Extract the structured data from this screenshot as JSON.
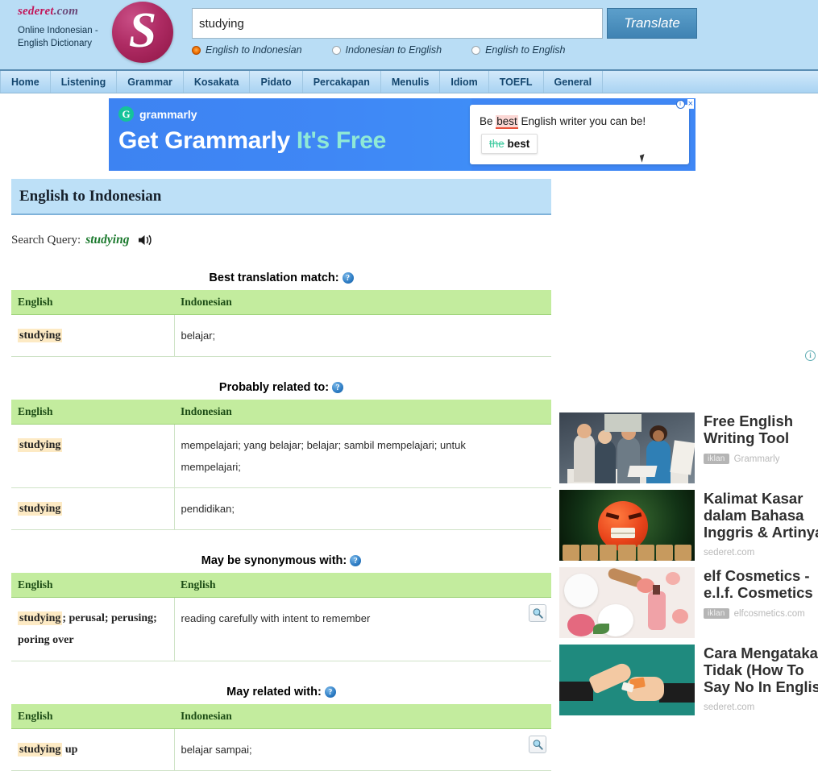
{
  "site": {
    "brand_name": "sederet",
    "brand_tld": ".com",
    "tagline_line1": "Online Indonesian -",
    "tagline_line2": "English Dictionary",
    "logo_letter": "S"
  },
  "search": {
    "value": "studying",
    "placeholder": "",
    "translate_label": "Translate",
    "directions": [
      {
        "label": "English to Indonesian",
        "selected": true
      },
      {
        "label": "Indonesian to English",
        "selected": false
      },
      {
        "label": "English to English",
        "selected": false
      }
    ]
  },
  "nav": {
    "items": [
      {
        "label": "Home"
      },
      {
        "label": "Listening"
      },
      {
        "label": "Grammar"
      },
      {
        "label": "Kosakata"
      },
      {
        "label": "Pidato"
      },
      {
        "label": "Percakapan"
      },
      {
        "label": "Menulis"
      },
      {
        "label": "Idiom"
      },
      {
        "label": "TOEFL"
      },
      {
        "label": "General"
      }
    ]
  },
  "banner_ad": {
    "logo_letter": "G",
    "brand": "grammarly",
    "headline_part1": "Get Grammarly ",
    "headline_part2": "It's Free",
    "card_text_before": "Be ",
    "card_text_highlight": "best",
    "card_text_after": " English writer you can be!",
    "suggest_strike": "the",
    "suggest_good": "best",
    "info_glyph": "i",
    "close_glyph": "×"
  },
  "page": {
    "title": "English to Indonesian",
    "query_label": "Search Query:",
    "query_word": "studying",
    "info_glyph": "i",
    "help_glyph": "?"
  },
  "sections": [
    {
      "heading": "Best translation match:",
      "columns": [
        "English",
        "Indonesian"
      ],
      "rows": [
        {
          "en_highlight": "studying",
          "en_rest": "",
          "target": "belajar;",
          "has_zoom": false
        }
      ]
    },
    {
      "heading": "Probably related to:",
      "columns": [
        "English",
        "Indonesian"
      ],
      "rows": [
        {
          "en_highlight": "studying",
          "en_rest": "",
          "target": "mempelajari; yang belajar; belajar; sambil mempelajari; untuk mempelajari;",
          "has_zoom": false
        },
        {
          "en_highlight": "studying",
          "en_rest": "",
          "target": "pendidikan;",
          "has_zoom": false
        }
      ]
    },
    {
      "heading": "May be synonymous with:",
      "columns": [
        "English",
        "English"
      ],
      "rows": [
        {
          "en_highlight": "studying",
          "en_rest": "; perusal; perusing; poring over",
          "target": "reading carefully with intent to remember",
          "has_zoom": true
        }
      ]
    },
    {
      "heading": "May related with:",
      "columns": [
        "English",
        "Indonesian"
      ],
      "rows": [
        {
          "en_highlight": "studying",
          "en_rest": " up",
          "target": "belajar sampai;",
          "has_zoom": true
        }
      ]
    }
  ],
  "rail_ads": [
    {
      "title_lines": [
        "Free English",
        "Writing Tool"
      ],
      "badge": "iklan",
      "source": "Grammarly",
      "thumb": "office-team-photo"
    },
    {
      "title_lines": [
        "Kalimat Kasar",
        "dalam Bahasa",
        "Inggris & Artinya"
      ],
      "badge": "",
      "source": "sederet.com",
      "thumb": "angry-emoji-photo"
    },
    {
      "title_lines": [
        "elf Cosmetics -",
        "e.l.f. Cosmetics"
      ],
      "badge": "iklan",
      "source": "elfcosmetics.com",
      "thumb": "cosmetics-photo"
    },
    {
      "title_lines": [
        "Cara Mengatakan",
        "Tidak (How To",
        "Say No In English)"
      ],
      "badge": "",
      "source": "sederet.com",
      "thumb": "hands-illustration"
    }
  ],
  "colors": {
    "header_bg": "#b9ddf5",
    "nav_bg": "#bbddf6",
    "title_bar_bg": "#bde0f7",
    "table_head_bg": "#c3ec9e",
    "highlight_bg": "#fdeac4",
    "query_green": "#1c7a2e",
    "brand_pink": "#c2185b"
  }
}
